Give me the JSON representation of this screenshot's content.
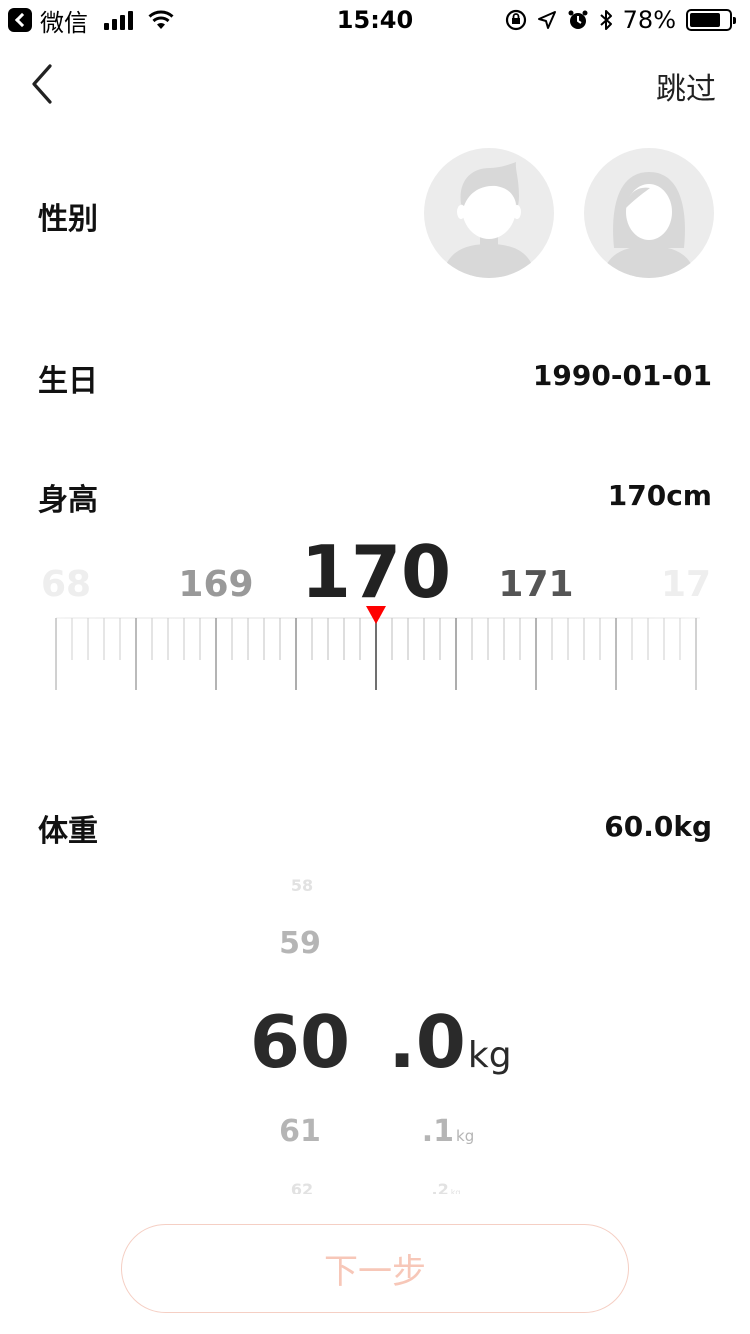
{
  "status_bar": {
    "app_name": "微信",
    "time": "15:40",
    "battery_percent": "78%",
    "battery_level": 0.78
  },
  "nav": {
    "skip_label": "跳过"
  },
  "gender": {
    "label": "性别"
  },
  "birthday": {
    "label": "生日",
    "value": "1990-01-01"
  },
  "height": {
    "label": "身高",
    "value": "170cm",
    "ruler": {
      "selected": 170,
      "labels": [
        "68",
        "169",
        "170",
        "171",
        "17"
      ],
      "accent_color": "#ff0000"
    }
  },
  "weight": {
    "label": "体重",
    "value": "60.0kg",
    "integer_column": [
      "58",
      "59",
      "60",
      "61",
      "62"
    ],
    "decimal_column": [
      ".0",
      ".1",
      ".2"
    ],
    "unit": "kg"
  },
  "next_button": {
    "label": "下一步",
    "color": "#f7c7b8"
  }
}
